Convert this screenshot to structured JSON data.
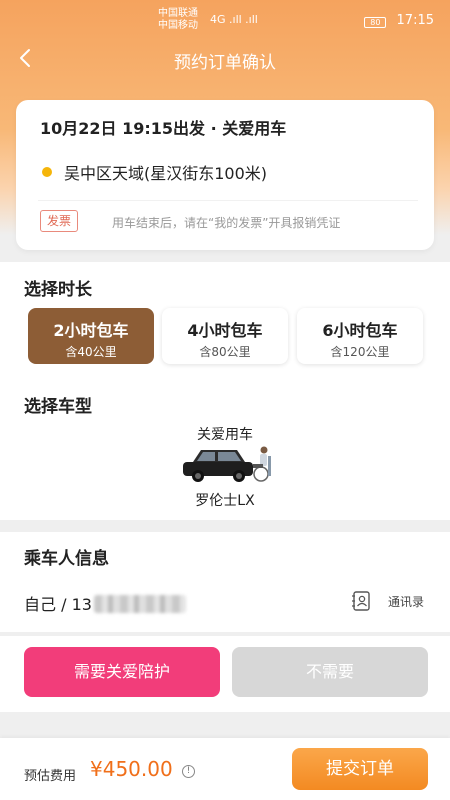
{
  "status_bar": {
    "carrier_1": "中国联通",
    "carrier_2": "中国移动",
    "signal_text": "4G .ıll .ıll",
    "battery": "80",
    "time": "17:15"
  },
  "nav": {
    "back_icon": "chevron-left-icon",
    "title": "预约订单确认"
  },
  "trip": {
    "summary": "10月22日 19:15出发 · 关爱用车",
    "address": "吴中区天域(星汉街东100米)",
    "invoice_tag": "发票",
    "invoice_note": "用车结束后，请在“我的发票”开具报销凭证"
  },
  "duration": {
    "title": "选择时长",
    "options": [
      {
        "label": "2小时包车",
        "sub": "含40公里",
        "selected": true
      },
      {
        "label": "4小时包车",
        "sub": "含80公里",
        "selected": false
      },
      {
        "label": "6小时包车",
        "sub": "含120公里",
        "selected": false
      }
    ]
  },
  "vehicle": {
    "title": "选择车型",
    "category": "关爱用车",
    "model": "罗伦士LX",
    "image_icon": "taxi-with-wheelchair-image"
  },
  "passenger": {
    "title": "乘车人信息",
    "value_prefix": "自己 / 13",
    "contacts_icon": "contact-book-icon",
    "contacts_label": "通讯录"
  },
  "escort": {
    "yes_label": "需要关爱陪护",
    "no_label": "不需要"
  },
  "footer": {
    "fee_label": "预估费用",
    "fee_amount": "¥450.00",
    "info_icon": "info-circle-icon",
    "submit_label": "提交订单"
  },
  "colors": {
    "header_orange": "#f5a35e",
    "selected_brown": "#8d5d36",
    "escort_pink": "#f23d7a",
    "price_orange": "#f06f1a",
    "submit_orange": "#f38a22"
  }
}
